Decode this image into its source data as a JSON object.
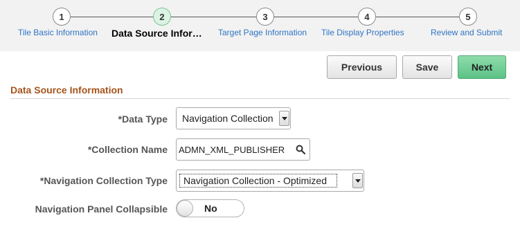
{
  "train": {
    "steps": [
      {
        "number": "1",
        "label": "Tile Basic Information"
      },
      {
        "number": "2",
        "label": "Data Source Infor…"
      },
      {
        "number": "3",
        "label": "Target Page Information"
      },
      {
        "number": "4",
        "label": "Tile Display Properties"
      },
      {
        "number": "5",
        "label": "Review and Submit"
      }
    ],
    "active_step": 2
  },
  "toolbar": {
    "previous_label": "Previous",
    "save_label": "Save",
    "next_label": "Next"
  },
  "section": {
    "title": "Data Source Information"
  },
  "form": {
    "data_type": {
      "label": "*Data Type",
      "value": "Navigation Collection"
    },
    "collection_name": {
      "label": "*Collection Name",
      "value": "ADMN_XML_PUBLISHER"
    },
    "nav_collection_type": {
      "label": "*Navigation Collection Type",
      "value": "Navigation Collection - Optimized"
    },
    "nav_panel_collapsible": {
      "label": "Navigation Panel Collapsible",
      "value": "No"
    }
  },
  "colors": {
    "section_title": "#a4541c",
    "link": "#2f73c4",
    "primary_button": "#5cc286",
    "active_step": "#dcf3e4"
  }
}
